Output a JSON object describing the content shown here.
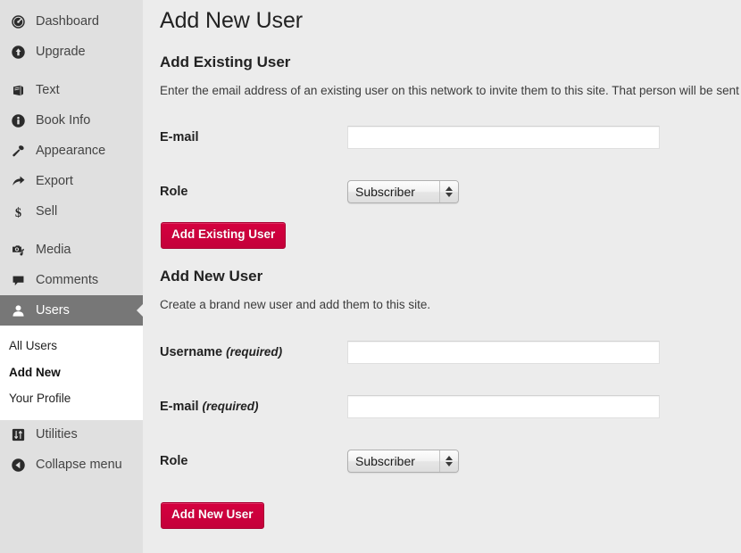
{
  "sidebar": {
    "groups": [
      {
        "items": [
          {
            "label": "Dashboard",
            "icon": "dashboard-gauge-icon",
            "active": false
          },
          {
            "label": "Upgrade",
            "icon": "upgrade-arrow-up-circle-icon",
            "active": false
          }
        ]
      },
      {
        "items": [
          {
            "label": "Text",
            "icon": "book-icon",
            "active": false
          },
          {
            "label": "Book Info",
            "icon": "info-circle-icon",
            "active": false
          },
          {
            "label": "Appearance",
            "icon": "paintbrush-icon",
            "active": false
          },
          {
            "label": "Export",
            "icon": "arrow-right-curve-icon",
            "active": false
          },
          {
            "label": "Sell",
            "icon": "dollar-sign-icon",
            "active": false
          }
        ]
      },
      {
        "items": [
          {
            "label": "Media",
            "icon": "media-camera-music-icon",
            "active": false
          },
          {
            "label": "Comments",
            "icon": "comment-bubble-icon",
            "active": false
          },
          {
            "label": "Users",
            "icon": "user-person-icon",
            "active": true
          }
        ]
      },
      {
        "items": [
          {
            "label": "Utilities",
            "icon": "utilities-sliders-icon",
            "active": false
          },
          {
            "label": "Collapse menu",
            "icon": "collapse-left-circle-icon",
            "active": false
          }
        ]
      }
    ],
    "submenu": [
      {
        "label": "All Users",
        "current": false
      },
      {
        "label": "Add New",
        "current": true
      },
      {
        "label": "Your Profile",
        "current": false
      }
    ]
  },
  "main": {
    "page_title": "Add New User",
    "existing": {
      "heading": "Add Existing User",
      "description": "Enter the email address of an existing user on this network to invite them to this site. That person will be sent",
      "email_label": "E-mail",
      "email_value": "",
      "role_label": "Role",
      "role_value": "Subscriber",
      "role_options": [
        "Subscriber"
      ],
      "submit_label": "Add Existing User"
    },
    "newuser": {
      "heading": "Add New User",
      "description": "Create a brand new user and add them to this site.",
      "username_label": "Username",
      "username_required": "(required)",
      "username_value": "",
      "email_label": "E-mail",
      "email_required": "(required)",
      "email_value": "",
      "role_label": "Role",
      "role_value": "Subscriber",
      "role_options": [
        "Subscriber"
      ],
      "submit_label": "Add New User"
    }
  },
  "colors": {
    "accent_red": "#cc003c",
    "sidebar_bg": "#e0e0e0",
    "active_item_bg": "#777777",
    "page_bg": "#ececec"
  }
}
